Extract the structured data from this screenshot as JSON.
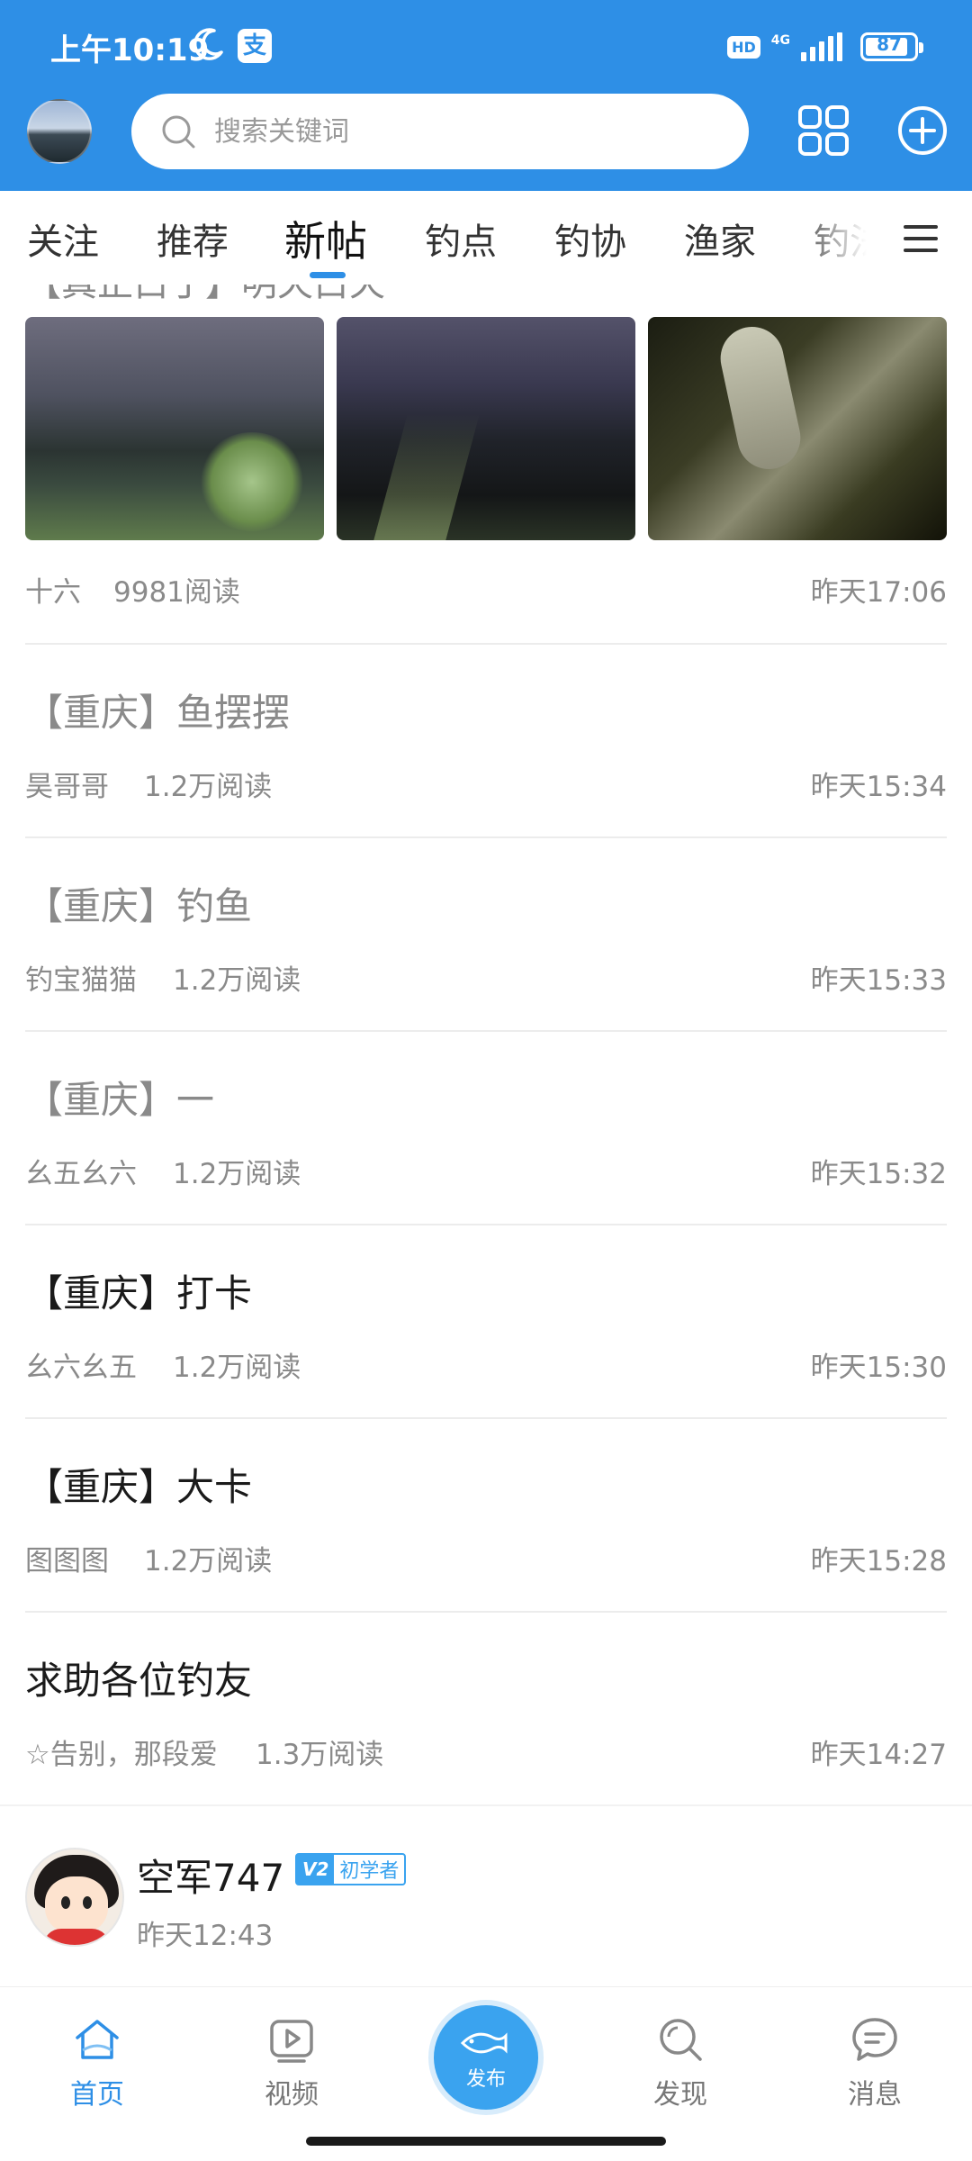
{
  "status_bar": {
    "time": "上午10:19",
    "alipay_glyph": "支",
    "hd_label": "HD",
    "network": "4G",
    "battery": "87"
  },
  "search": {
    "placeholder": "搜索关键词"
  },
  "tabs": [
    {
      "label": "关注"
    },
    {
      "label": "推荐"
    },
    {
      "label": "新帖"
    },
    {
      "label": "钓点"
    },
    {
      "label": "钓协"
    },
    {
      "label": "渔家"
    },
    {
      "label": "钓法"
    }
  ],
  "feed": {
    "cut_title": "【真正白丁】明天白天",
    "first_post": {
      "author": "十六",
      "reads": "9981阅读",
      "time": "昨天17:06"
    },
    "posts": [
      {
        "title": "【重庆】鱼摆摆",
        "author": "昊哥哥",
        "reads": "1.2万阅读",
        "time": "昨天15:34"
      },
      {
        "title": "【重庆】钓鱼",
        "author": "钓宝猫猫",
        "reads": "1.2万阅读",
        "time": "昨天15:33"
      },
      {
        "title": "【重庆】一",
        "author": "幺五幺六",
        "reads": "1.2万阅读",
        "time": "昨天15:32"
      },
      {
        "title": "【重庆】打卡",
        "author": "幺六幺五",
        "reads": "1.2万阅读",
        "time": "昨天15:30"
      },
      {
        "title": "【重庆】大卡",
        "author": "图图图",
        "reads": "1.2万阅读",
        "time": "昨天15:28"
      },
      {
        "title": "求助各位钓友",
        "author": "☆告别，那段爱",
        "reads": "1.3万阅读",
        "time": "昨天14:27"
      }
    ]
  },
  "user_card": {
    "name": "空军747",
    "level": "V2",
    "badge": "初学者",
    "time": "昨天12:43"
  },
  "bottom_nav": {
    "home": "首页",
    "video": "视频",
    "publish": "发布",
    "discover": "发现",
    "messages": "消息"
  },
  "colors": {
    "brand_blue": "#2e8fe6",
    "badge_blue": "#3aa3ef",
    "meta_gray": "#8a8a8a"
  }
}
